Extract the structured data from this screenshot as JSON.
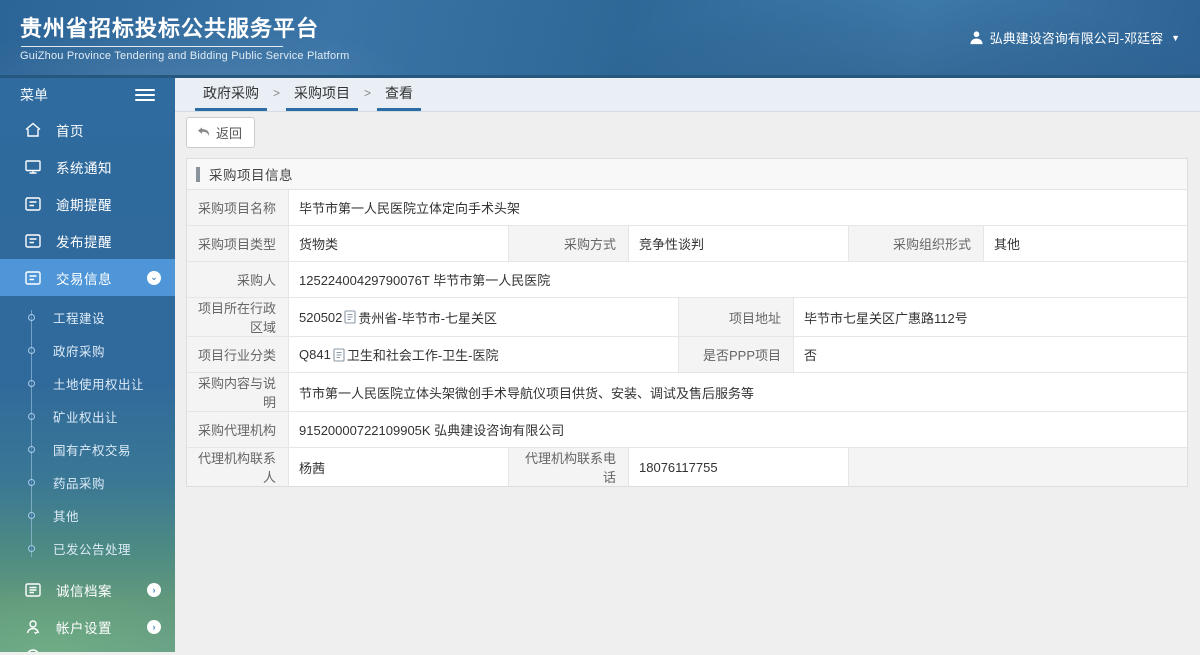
{
  "header": {
    "title": "贵州省招标投标公共服务平台",
    "subtitle": "GuiZhou Province Tendering and Bidding Public Service Platform",
    "user_name": "弘典建设咨询有限公司-邓廷容"
  },
  "sidebar": {
    "menu_label": "菜单",
    "items": [
      {
        "label": "首页",
        "icon": "home-icon"
      },
      {
        "label": "系统通知",
        "icon": "monitor-icon"
      },
      {
        "label": "逾期提醒",
        "icon": "list-card-icon"
      },
      {
        "label": "发布提醒",
        "icon": "list-card-icon"
      },
      {
        "label": "交易信息",
        "icon": "list-card-icon",
        "active": true,
        "state": "expanded"
      },
      {
        "label": "诚信档案",
        "icon": "archive-icon",
        "state": "collapsed"
      },
      {
        "label": "帐户设置",
        "icon": "user-icon",
        "state": "collapsed"
      }
    ],
    "trade_submenu": [
      "工程建设",
      "政府采购",
      "土地使用权出让",
      "矿业权出让",
      "国有产权交易",
      "药品采购",
      "其他",
      "已发公告处理"
    ]
  },
  "breadcrumb": [
    "政府采购",
    "采购项目",
    "查看"
  ],
  "toolbar": {
    "back_label": "返回",
    "back_icon": "undo-arrow-icon"
  },
  "panel": {
    "title": "采购项目信息",
    "fields": {
      "project_name": {
        "label": "采购项目名称",
        "value": "毕节市第一人民医院立体定向手术头架"
      },
      "project_type": {
        "label": "采购项目类型",
        "value": "货物类"
      },
      "purchase_method": {
        "label": "采购方式",
        "value": "竞争性谈判"
      },
      "org_form": {
        "label": "采购组织形式",
        "value": "其他"
      },
      "purchaser": {
        "label": "采购人",
        "value": "12522400429790076T 毕节市第一人民医院"
      },
      "region": {
        "label": "项目所在行政区域",
        "code": "520502",
        "value": "贵州省-毕节市-七星关区"
      },
      "address": {
        "label": "项目地址",
        "value": "毕节市七星关区广惠路112号"
      },
      "industry": {
        "label": "项目行业分类",
        "code": "Q841",
        "value": "卫生和社会工作-卫生-医院"
      },
      "is_ppp": {
        "label": "是否PPP项目",
        "value": "否"
      },
      "content": {
        "label": "采购内容与说明",
        "value": "节市第一人民医院立体头架微创手术导航仪项目供货、安装、调试及售后服务等"
      },
      "agency": {
        "label": "采购代理机构",
        "value": "91520000722109905K 弘典建设咨询有限公司"
      },
      "agency_contact": {
        "label": "代理机构联系人",
        "value": "杨茜"
      },
      "agency_phone": {
        "label": "代理机构联系电话",
        "value": "18076117755"
      }
    }
  },
  "colors": {
    "sidebar_blue": "#306b9e",
    "active_item_blue": "#4e96d8",
    "crumb_underline": "#2c6da5",
    "header_edge": "#25577f"
  }
}
